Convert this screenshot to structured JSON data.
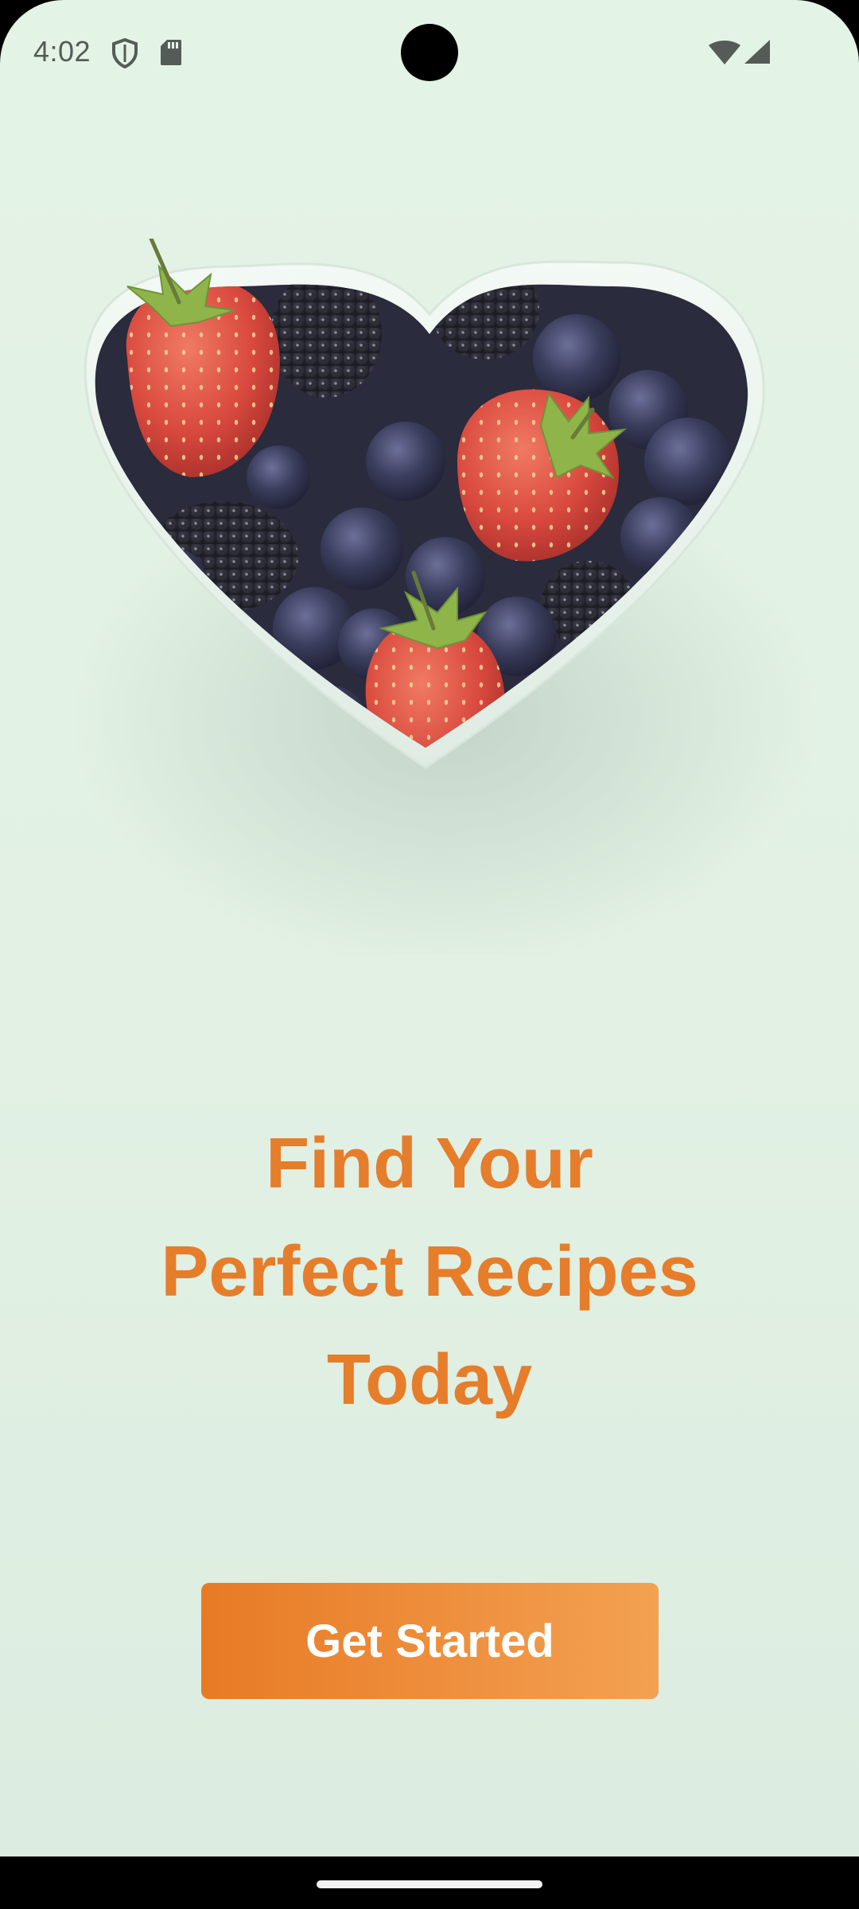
{
  "status_bar": {
    "time": "4:02",
    "icons": [
      "shield-icon",
      "sd-card-icon",
      "wifi-icon",
      "cell-signal-icon"
    ]
  },
  "hero_image": {
    "subject": "heart-shaped bowl of strawberries, blackberries and blueberries"
  },
  "headline": {
    "line1": "Find Your",
    "line2": "Perfect Recipes",
    "line3": "Today",
    "color": "#e67d2b"
  },
  "cta": {
    "label": "Get Started",
    "gradient_start": "#e87a25",
    "gradient_end": "#f3a152"
  },
  "colors": {
    "background": "#e2f1e4",
    "accent": "#e67d2b"
  }
}
